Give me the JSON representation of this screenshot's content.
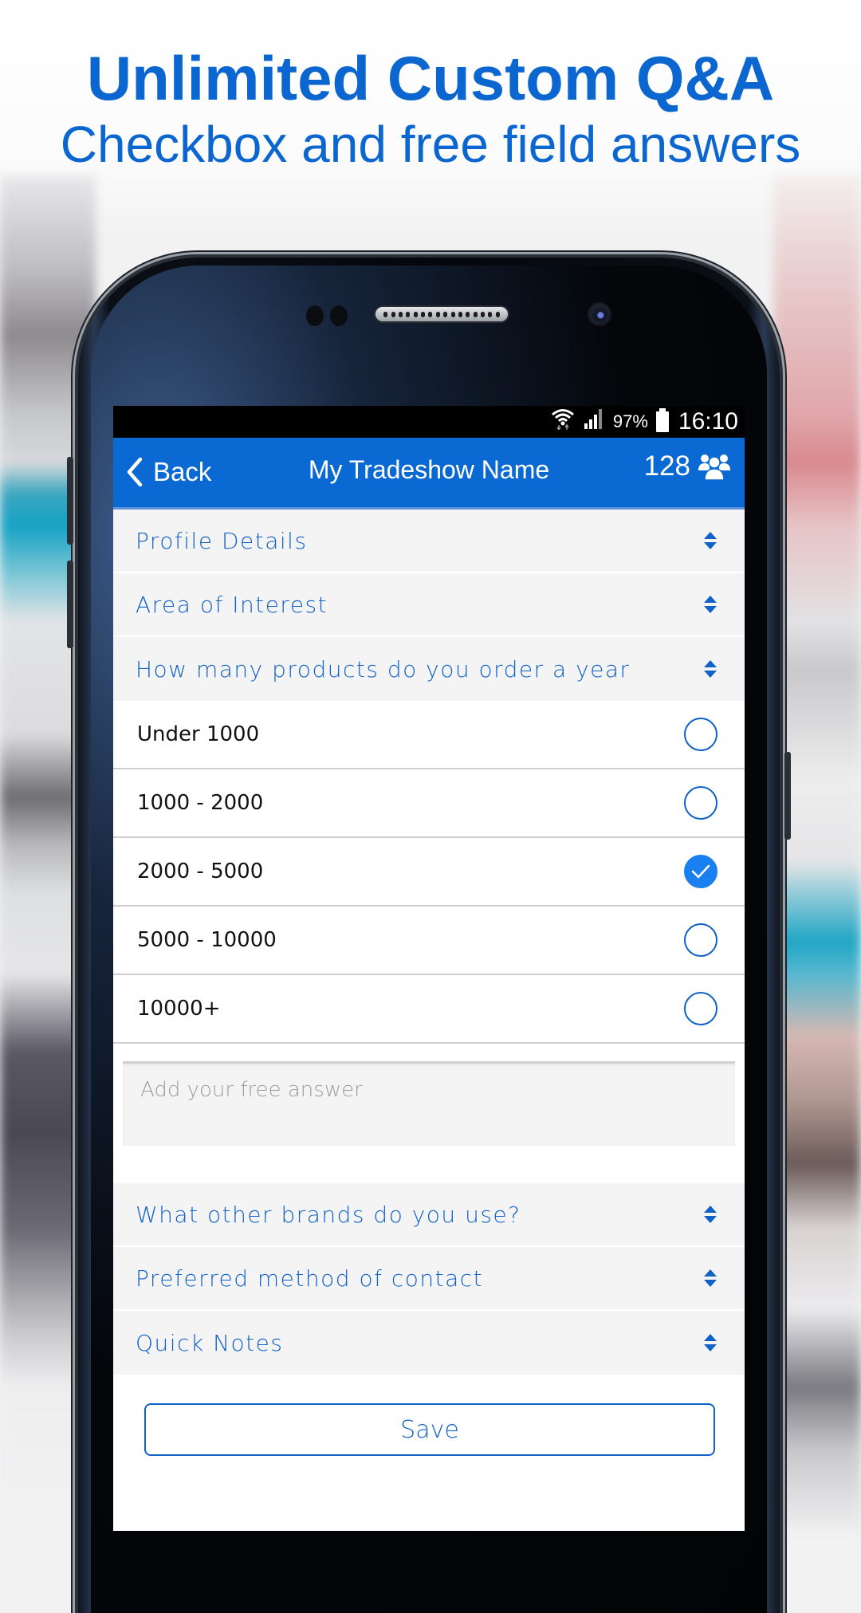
{
  "headline": {
    "title": "Unlimited Custom Q&A",
    "subtitle": "Checkbox and free field answers"
  },
  "colors": {
    "brand_blue": "#0a69d3",
    "accent_text": "#1162c7",
    "checked": "#1a80f0"
  },
  "status_bar": {
    "wifi_icon": "wifi-icon",
    "signal_icon": "signal-icon",
    "battery_percent": "97%",
    "battery_icon": "battery-icon",
    "time": "16:10"
  },
  "nav": {
    "back_label": "Back",
    "title": "My Tradeshow Name",
    "attendee_count": "128",
    "attendee_icon": "users-group-icon"
  },
  "sections_top": [
    {
      "label": "Profile Details",
      "icon": "sort-icon"
    },
    {
      "label": "Area of Interest",
      "icon": "sort-icon"
    },
    {
      "label": "How many products do you order a year",
      "icon": "sort-icon"
    }
  ],
  "question": {
    "options": [
      {
        "label": "Under 1000",
        "checked": false
      },
      {
        "label": "1000 - 2000",
        "checked": false
      },
      {
        "label": "2000 - 5000",
        "checked": true
      },
      {
        "label": "5000 - 10000",
        "checked": false
      },
      {
        "label": "10000+",
        "checked": false
      }
    ],
    "free_answer_placeholder": "Add your free answer",
    "free_answer_value": ""
  },
  "sections_bottom": [
    {
      "label": "What other brands do you use?",
      "icon": "sort-icon"
    },
    {
      "label": "Preferred method of contact",
      "icon": "sort-icon"
    },
    {
      "label": "Quick Notes",
      "icon": "sort-icon"
    }
  ],
  "save_label": "Save"
}
